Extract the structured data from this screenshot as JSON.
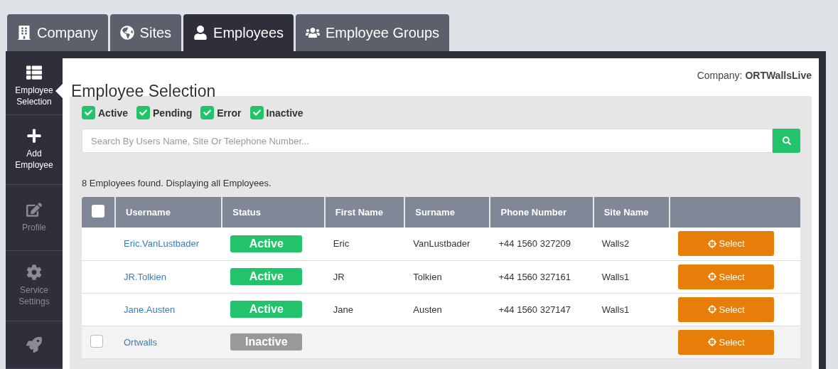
{
  "tabs": [
    {
      "label": "Company",
      "selected": false
    },
    {
      "label": "Sites",
      "selected": false
    },
    {
      "label": "Employees",
      "selected": true
    },
    {
      "label": "Employee Groups",
      "selected": false
    }
  ],
  "sidebar": {
    "items": [
      {
        "label": "Employee Selection",
        "selected": true,
        "disabled": false
      },
      {
        "label": "Add Employee",
        "selected": false,
        "disabled": false
      },
      {
        "label": "Profile",
        "selected": false,
        "disabled": true
      },
      {
        "label": "Service Settings",
        "selected": false,
        "disabled": true
      },
      {
        "selected": false,
        "disabled": true
      }
    ]
  },
  "page": {
    "title": "Employee Selection",
    "company_label": "Company:",
    "company_name": "ORTWallsLive"
  },
  "filters": [
    {
      "label": "Active",
      "checked": true
    },
    {
      "label": "Pending",
      "checked": true
    },
    {
      "label": "Error",
      "checked": true
    },
    {
      "label": "Inactive",
      "checked": true
    }
  ],
  "search": {
    "placeholder": "Search By Users Name, Site Or Telephone Number..."
  },
  "result_text": "8 Employees found. Displaying all Employees.",
  "table": {
    "select_all_checked": false,
    "columns": [
      "Username",
      "Status",
      "First Name",
      "Surname",
      "Phone Number",
      "Site Name"
    ],
    "rows": [
      {
        "kind": "plain",
        "username": "Eric.VanLustbader",
        "status": "Active",
        "status_active": true,
        "first_name": "Eric",
        "surname": "VanLustbader",
        "phone": "+44 1560 327209",
        "site": "Walls2",
        "action": "Select"
      },
      {
        "kind": "plain",
        "username": "JR.Tolkien",
        "status": "Active",
        "status_active": true,
        "first_name": "JR",
        "surname": "Tolkien",
        "phone": "+44 1560 327161",
        "site": "Walls1",
        "action": "Select"
      },
      {
        "kind": "plain",
        "username": "Jane.Austen",
        "status": "Active",
        "status_active": true,
        "first_name": "Jane",
        "surname": "Austen",
        "phone": "+44 1560 327147",
        "site": "Walls1",
        "action": "Select"
      },
      {
        "kind": "checkable",
        "checked": false,
        "username": "Ortwalls",
        "status": "Inactive",
        "status_active": false,
        "action": "Select"
      }
    ]
  }
}
